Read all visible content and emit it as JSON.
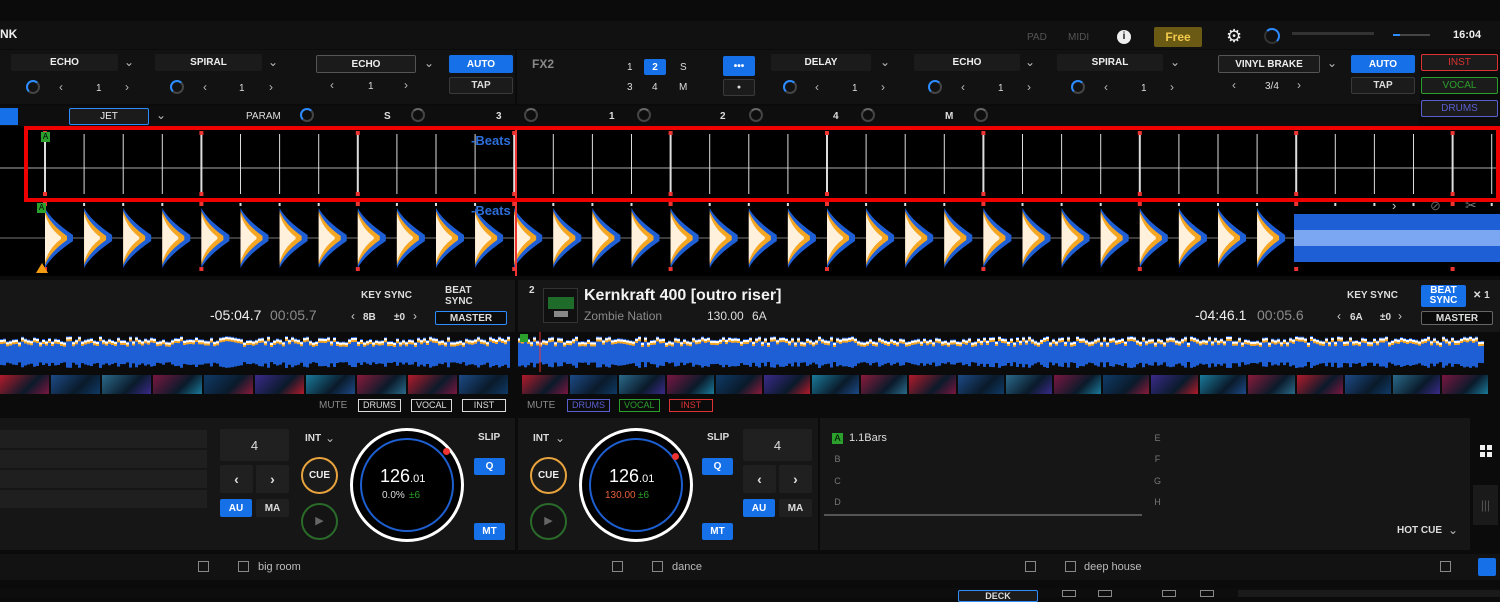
{
  "topbar": {
    "brand": "NK",
    "pad": "PAD",
    "midi": "MIDI",
    "plan": "Free",
    "time": "16:04"
  },
  "fx1": {
    "slot1": "ECHO",
    "slot2": "SPIRAL",
    "slot3": "ECHO",
    "val1": "1",
    "val2": "1",
    "val3": "1",
    "auto": "AUTO",
    "tap": "TAP"
  },
  "fx2": {
    "label": "FX2",
    "beats": [
      "1",
      "2",
      "S",
      "3",
      "4",
      "M"
    ],
    "more": "•••",
    "dot": "●",
    "slot1": "DELAY",
    "slot2": "ECHO",
    "slot3": "SPIRAL",
    "slot4": "VINYL BRAKE",
    "val1": "1",
    "val2": "1",
    "val3": "1",
    "val4": "3/4",
    "auto": "AUTO",
    "tap": "TAP"
  },
  "stems_right": {
    "inst": "INST",
    "vocal": "VOCAL",
    "drums": "DRUMS"
  },
  "paramrow": {
    "jet": "JET",
    "param": "PARAM",
    "s": "S",
    "n3": "3",
    "n1": "1",
    "n2": "2",
    "n4": "4",
    "m": "M"
  },
  "grid": {
    "marker": "A",
    "beats_label": "-Beats"
  },
  "deck1": {
    "key_sync": "KEY SYNC",
    "beat_sync": "BEAT SYNC",
    "remaining": "-05:04.7",
    "elapsed": "00:05.7",
    "key": "8B",
    "pitch": "±0",
    "master": "MASTER",
    "mute": "MUTE",
    "drums": "DRUMS",
    "vocal": "VOCAL",
    "inst": "INST",
    "loop": "4",
    "int": "INT",
    "cue": "CUE",
    "slip": "SLIP",
    "q": "Q",
    "au": "AU",
    "ma": "MA",
    "mt": "MT",
    "bpm_main": "126",
    "bpm_dec": ".01",
    "pitch_pct": "0.0%",
    "pitch_range": "±6"
  },
  "deck2": {
    "number": "2",
    "title": "Kernkraft 400 [outro riser]",
    "artist": "Zombie Nation",
    "bpm": "130.00",
    "key_label": "6A",
    "key_sync": "KEY SYNC",
    "beat_sync": "BEAT SYNC",
    "x1": "✕ 1",
    "remaining": "-04:46.1",
    "elapsed": "00:05.6",
    "key": "6A",
    "pitch": "±0",
    "master": "MASTER",
    "mute": "MUTE",
    "drums": "DRUMS",
    "vocal": "VOCAL",
    "inst": "INST",
    "loop": "4",
    "int": "INT",
    "cue": "CUE",
    "slip": "SLIP",
    "q": "Q",
    "au": "AU",
    "ma": "MA",
    "mt": "MT",
    "bpm_main": "126",
    "bpm_dec": ".01",
    "orig_bpm": "130.00",
    "pitch_range": "±6"
  },
  "hotcue": {
    "a": "1.1Bars",
    "labels": [
      "A",
      "B",
      "C",
      "D",
      "E",
      "F",
      "G",
      "H"
    ],
    "mode": "HOT CUE"
  },
  "browser": {
    "tab1": "big room",
    "tab2": "dance",
    "tab3": "deep house",
    "deck": "DECK"
  }
}
